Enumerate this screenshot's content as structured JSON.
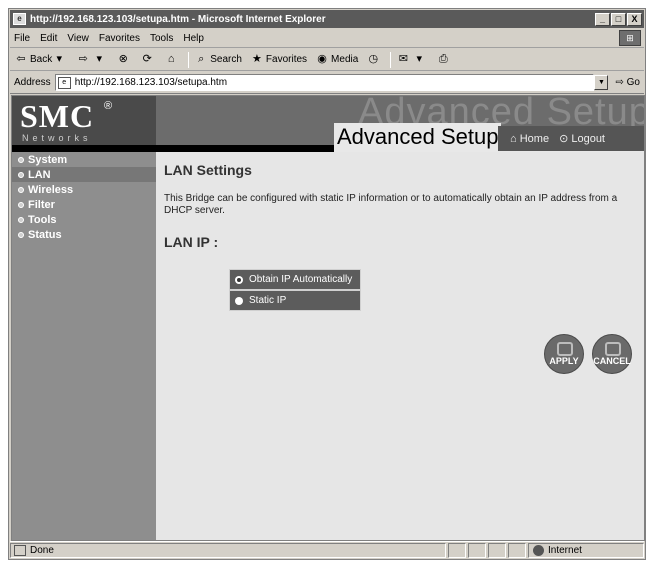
{
  "window": {
    "title": "http://192.168.123.103/setupa.htm - Microsoft Internet Explorer",
    "buttons": [
      "_",
      "□",
      "X"
    ]
  },
  "menubar": {
    "items": [
      {
        "label": "File"
      },
      {
        "label": "Edit"
      },
      {
        "label": "View"
      },
      {
        "label": "Favorites"
      },
      {
        "label": "Tools"
      },
      {
        "label": "Help"
      }
    ]
  },
  "toolbar": {
    "back": "Back",
    "search": "Search",
    "favorites": "Favorites",
    "media": "Media"
  },
  "address": {
    "label": "Address",
    "url": "http://192.168.123.103/setupa.htm",
    "go": "Go"
  },
  "header": {
    "logo": "SMC",
    "logo_mark": "®",
    "subtitle": "Networks",
    "bg_title": "Advanced Setup",
    "title": "Advanced Setup",
    "home": "Home",
    "logout": "Logout"
  },
  "sidebar": {
    "items": [
      {
        "label": "System"
      },
      {
        "label": "LAN"
      },
      {
        "label": "Wireless"
      },
      {
        "label": "Filter"
      },
      {
        "label": "Tools"
      },
      {
        "label": "Status"
      }
    ],
    "active": "LAN"
  },
  "main": {
    "title": "LAN Settings",
    "description": "This Bridge can be configured with static IP information or to automatically obtain an IP address from a DHCP server.",
    "section_title": "LAN IP :",
    "options": [
      {
        "label": "Obtain IP Automatically",
        "selected": true
      },
      {
        "label": "Static IP",
        "selected": false
      }
    ],
    "apply": "APPLY",
    "cancel": "CANCEL"
  },
  "status": {
    "text": "Done",
    "zone": "Internet"
  }
}
